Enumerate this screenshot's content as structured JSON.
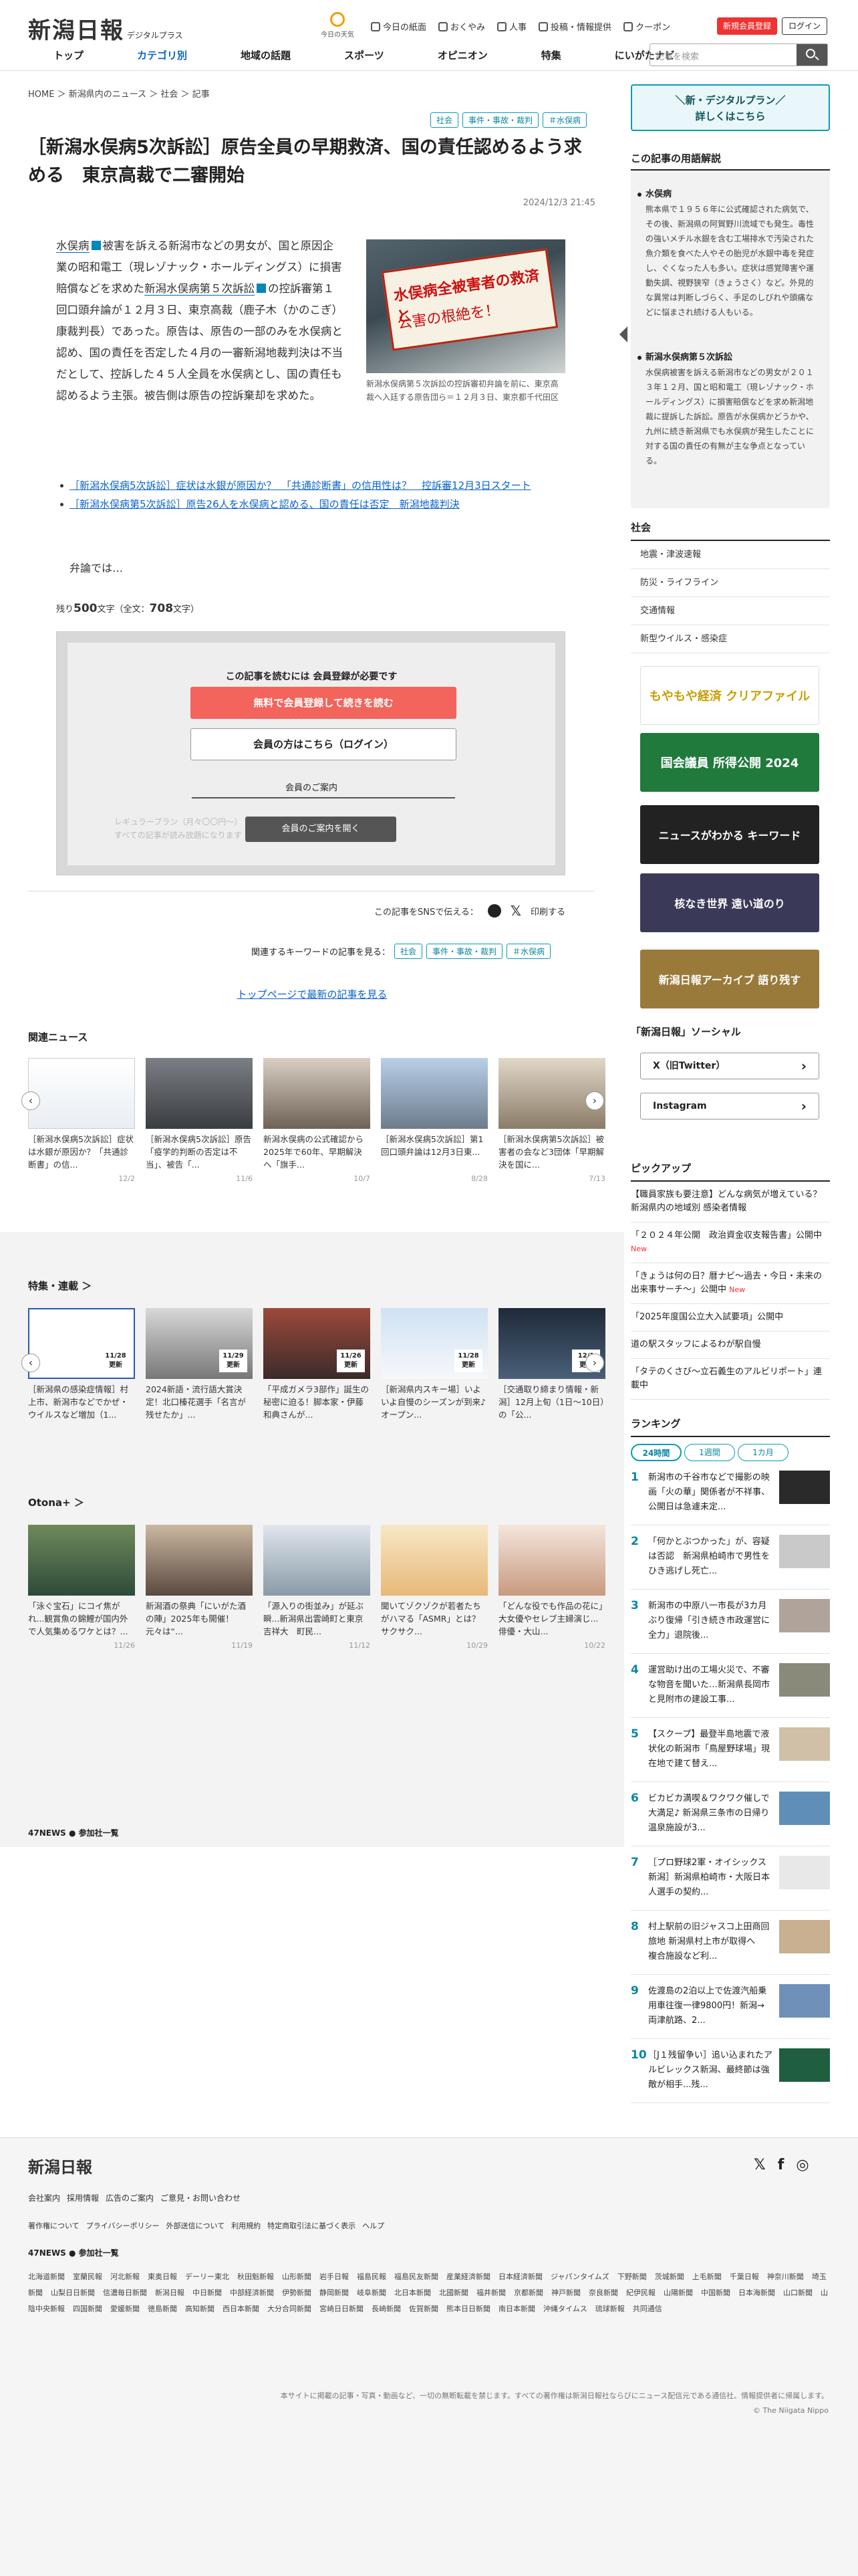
{
  "header": {
    "logo": "新潟日報",
    "logo_sub": "デジタルプラス",
    "weather": "今日の天気",
    "util": [
      "今日の紙面",
      "おくやみ",
      "人事",
      "投稿・情報提供",
      "クーポン"
    ],
    "register": "新規会員登録",
    "login": "ログイン",
    "nav": [
      "トップ",
      "カテゴリ別",
      "地域の話題",
      "スポーツ",
      "オピニオン",
      "特集",
      "にいがたナビ"
    ],
    "search_placeholder": "記事を検索"
  },
  "breadcrumb": "HOME ＞ 新潟県内のニュース ＞ 社会 ＞ 記事",
  "tags": [
    "社会",
    "事件・事故・裁判",
    "＃水俣病"
  ],
  "article": {
    "title": "［新潟水俣病5次訴訟］原告全員の早期救済、国の責任認めるよう求める　東京高裁で二審開始",
    "date": "2024/12/3 21:45",
    "body_a": "水俣病",
    "body_b": "被害を訴える新潟市などの男女が、国と原因企業の昭和電工（現レゾナック・ホールディングス）に損害賠償などを求めた",
    "body_c": "新潟水俣病第５次訴訟",
    "body_d": "の控訴審第１回口頭弁論が１２月３日、東京高裁（鹿子木（かのこぎ）康裁判長）であった。原告は、原告の一部のみを水俣病と認め、国の責任を否定した４月の一審新潟地裁判決は不当だとして、控訴した４５人全員を水俣病とし、国の責任も認めるよう主張。被告側は原告の控訴棄却を求めた。",
    "photo_banner1": "水俣病全被害者の救済と",
    "photo_banner2": "公害の根絶を！",
    "caption": "新潟水俣病第５次訴訟の控訴審初弁論を前に、東京高裁へ入廷する原告団ら＝１２月３日、東京都千代田区",
    "related": [
      "［新潟水俣病5次訴訟］症状は水銀が原因か？　「共通診断書」の信用性は？　控訴審12月3日スタート",
      "［新潟水俣病第5次訴訟］原告26人を水俣病と認める、国の責任は否定　新潟地裁判決"
    ],
    "body_end": "弁論では…",
    "remain_pre": "残り",
    "remain_num": "500",
    "remain_post": "文字（全文：",
    "total_num": "708",
    "total_post": "文字）"
  },
  "paywall": {
    "heading": "この記事を読むには 会員登録が必要です",
    "register": "無料で会員登録して続きを読む",
    "login": "会員の方はこちら（ログイン）",
    "guide": "会員のご案内",
    "blur1": "レギュラープラン（月々〇〇円〜）",
    "blur2": "すべての記事が読み放題になります",
    "open": "会員のご案内を開く"
  },
  "share": {
    "label": "この記事をSNSで伝える：",
    "print": "印刷する"
  },
  "keywords": {
    "label": "関連するキーワードの記事を見る："
  },
  "backtop": "トップページで最新の記事を見る",
  "related_news": {
    "heading": "関連ニュース",
    "items": [
      {
        "t": "［新潟水俣病5次訴訟］症状は水銀が原因か？「共通診断書」の信...",
        "d": "12/2"
      },
      {
        "t": "［新潟水俣病5次訴訟］原告「疫学的判断の否定は不当」、被告「...",
        "d": "11/6"
      },
      {
        "t": "新潟水俣病の公式確認から2025年で60年、早期解決へ「旗手...",
        "d": "10/7"
      },
      {
        "t": "［新潟水俣病5次訴訟］第1回口頭弁論は12月3日東...",
        "d": "8/28"
      },
      {
        "t": "［新潟水俣病第5次訴訟］被害者の会など3団体「早期解決を国に...",
        "d": "7/13"
      }
    ]
  },
  "features": {
    "heading": "特集・連載 ＞",
    "badge": "更新",
    "items": [
      {
        "t": "［新潟県の感染症情報］村上市、新潟市などでかぜ・ウイルスなど増加（1...",
        "d": "11/28"
      },
      {
        "t": "2024新語・流行語大賞決定！北口榛花選手「名言が残せたか」...",
        "d": "11/29"
      },
      {
        "t": "「平成ガメラ3部作」誕生の秘密に迫る！脚本家・伊藤和典さんが...",
        "d": "11/26"
      },
      {
        "t": "［新潟県内スキー場］いよいよ自慢のシーズンが到来♪オープン...",
        "d": "11/28"
      },
      {
        "t": "［交通取り締まり情報・新潟］12月上旬（1日〜10日）の「公...",
        "d": "12/1"
      }
    ]
  },
  "otona": {
    "heading": "Otona+ ＞",
    "items": [
      {
        "t": "「泳ぐ宝石」にコイ焦がれ...観賞魚の錦鯉が国内外で人気集めるワケとは？...",
        "d": "11/26"
      },
      {
        "t": "新潟酒の祭典「にいがた酒の陣」2025年も開催！　元々は“...",
        "d": "11/19"
      },
      {
        "t": "「源入りの街並み」が延ぶ瞬...新潟県出雲崎町と東京吉祥大　町民...",
        "d": "11/12"
      },
      {
        "t": "聞いてゾクゾクが若者たちがハマる「ASMR」とは？　サクサク...",
        "d": "10/29"
      },
      {
        "t": "「どんな役でも作品の花に」大女優やセレブ主婦演じ...俳優・大山...",
        "d": "10/22"
      }
    ]
  },
  "news47": "47NEWS ● 参加社一覧",
  "sidebar": {
    "premium1": "＼新・デジタルプラン／",
    "premium2": "詳しくはこちら",
    "glossary_title": "この記事の用語解説",
    "g1_title": "水俣病",
    "g1_text": "熊本県で１９５６年に公式確認された病気で、その後、新潟県の阿賀野川流域でも発生。毒性の強いメチル水銀を含む工場排水で汚染された魚介類を食べた人やその胎児が水銀中毒を発症し、ぐくなった人も多い。症状は感覚障害や運動失調、視野狭窄（きょうさく）など。外見的な異常は判断しづらく、手足のしびれや頭痛などに悩まされ続ける人もいる。",
    "g2_title": "新潟水俣病第５次訴訟",
    "g2_text": "水俣病被害を訴える新潟市などの男女が２０１３年１２月、国と昭和電工（現レゾナック・ホールディングス）に損害賠償などを求め新潟地裁に提訴した訴訟。原告が水俣病かどうかや、九州に続き新潟県でも水俣病が発生したことに対する国の責任の有無が主な争点となっている。",
    "social_title": "社会",
    "social": [
      "地震・津波速報",
      "防災・ライフライン",
      "交通情報",
      "新型ウイルス・感染症"
    ],
    "banners": [
      "もやもや経済 クリアファイル",
      "国会議員 所得公開 2024",
      "ニュースがわかる キーワード",
      "核なき世界 遠い道のり",
      "新潟日報アーカイブ 語り残す"
    ],
    "sns_title": "「新潟日報」ソーシャル",
    "sns": [
      "X（旧Twitter）",
      "Instagram"
    ],
    "pick_title": "ピックアップ",
    "picks": [
      "【職員家族も要注意】どんな病気が増えている？ 新潟県内の地域別 感染者情報",
      "「２０２４年公開　政治資金収支報告書」公開中",
      "「きょうは何の日？暦ナビ～過去・今日・未来の出来事サーチ～」公開中",
      "「2025年度国公立大入試要項」公開中",
      "道の駅スタッフによるわが駅自慢",
      "「タテのくさび～立石義生のアルビリポート」連載中"
    ],
    "pick_new": "New",
    "rank_title": "ランキング",
    "rank_tabs": [
      "24時間",
      "1週間",
      "1カ月"
    ],
    "ranks": [
      "新潟市の千谷市などで撮影の映画「火の華」関係者が不祥事、公開日は急遽未定...",
      "「何かとぶつかった」が、容疑は否認　新潟県柏崎市で男性をひき逃げし死亡...",
      "新潟市の中原八一市長が3カ月ぶり復帰「引き続き市政運営に全力」退院後...",
      "運営助け出の工場火災で、不審な物音を聞いた…新潟県長岡市と見附市の建設工事...",
      "【スクープ】最登半島地震で液状化の新潟市「鳥屋野球場」現在地で建て替え...",
      "ビカビカ満喫＆ワクワク催しで大満足♪ 新潟県三条市の日帰り温泉施設が3...",
      "［プロ野球2軍・オイシックス新潟］新潟県柏崎市・大阪日本人選手の契約...",
      "村上駅前の旧ジャスコ上田商回旅地 新潟県村上市が取得へ　複合施設など利...",
      "佐渡島の2泊以上で佐渡汽船乗用車往復一律9800円！新潟→両津航路、2...",
      "［J１残留争い］追い込まれたアルビレックス新潟、最終節は強敵が相手...残..."
    ]
  },
  "footer": {
    "logo": "新潟日報",
    "links1": [
      "会社案内",
      "採用情報",
      "広告のご案内",
      "ご意見・お問い合わせ"
    ],
    "links2": [
      "著作権について",
      "プライバシーポリシー",
      "外部送信について",
      "利用規約",
      "特定商取引法に基づく表示",
      "ヘルプ"
    ],
    "network": [
      "北海道新聞",
      "室蘭民報",
      "河北新報",
      "東奥日報",
      "デーリー東北",
      "秋田魁新報",
      "山形新聞",
      "岩手日報",
      "福島民報",
      "福島民友新聞",
      "産業経済新聞",
      "日本経済新聞",
      "ジャパンタイムズ",
      "下野新聞",
      "茨城新聞",
      "上毛新聞",
      "千葉日報",
      "神奈川新聞",
      "埼玉新聞",
      "山梨日日新聞",
      "信濃毎日新聞",
      "新潟日報",
      "中日新聞",
      "中部経済新聞",
      "伊勢新聞",
      "静岡新聞",
      "岐阜新聞",
      "北日本新聞",
      "北國新聞",
      "福井新聞",
      "京都新聞",
      "神戸新聞",
      "奈良新聞",
      "紀伊民報",
      "山陽新聞",
      "中国新聞",
      "日本海新聞",
      "山口新聞",
      "山陰中央新報",
      "四国新聞",
      "愛媛新聞",
      "徳島新聞",
      "高知新聞",
      "西日本新聞",
      "大分合同新聞",
      "宮崎日日新聞",
      "長崎新聞",
      "佐賀新聞",
      "熊本日日新聞",
      "南日本新聞",
      "沖縄タイムス",
      "琉球新報",
      "共同通信"
    ],
    "copyright1": "本サイトに掲載の記事・写真・動画など、一切の無断転載を禁じます。すべての著作権は新潟日報社ならびにニュース配信元である通信社、情報提供者に帰属します。",
    "copyright2": "© The Niigata Nippo"
  },
  "colors": {
    "accent": "#0a63c8",
    "tag": "#0a9bb5",
    "register": "#f2645c"
  }
}
